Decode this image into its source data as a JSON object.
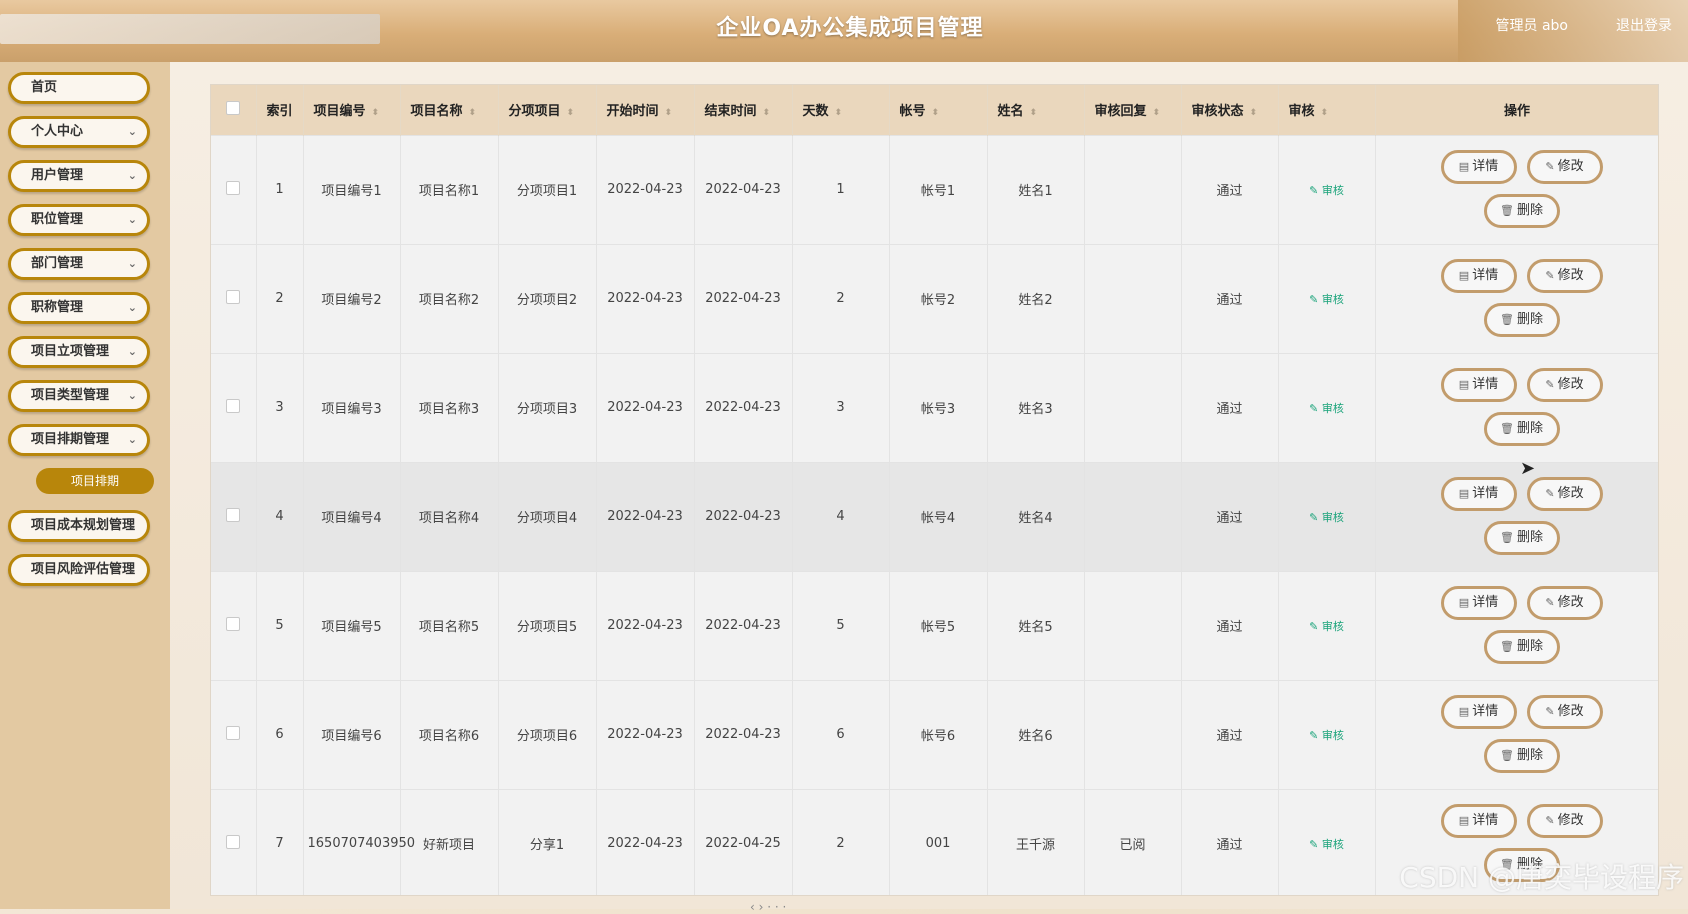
{
  "header": {
    "title": "企业OA办公集成项目管理",
    "user": "管理员 abo",
    "logout": "退出登录"
  },
  "sidebar": {
    "items": [
      {
        "label": "首页",
        "expandable": false
      },
      {
        "label": "个人中心",
        "expandable": true
      },
      {
        "label": "用户管理",
        "expandable": true
      },
      {
        "label": "职位管理",
        "expandable": true
      },
      {
        "label": "部门管理",
        "expandable": true
      },
      {
        "label": "职称管理",
        "expandable": true
      },
      {
        "label": "项目立项管理",
        "expandable": true
      },
      {
        "label": "项目类型管理",
        "expandable": true
      },
      {
        "label": "项目排期管理",
        "expandable": true
      },
      {
        "label": "项目成本规划管理",
        "expandable": true
      },
      {
        "label": "项目风险评估管理",
        "expandable": true
      }
    ],
    "active_sub": "项目排期"
  },
  "table": {
    "columns": [
      "索引",
      "项目编号",
      "项目名称",
      "分项项目",
      "开始时间",
      "结束时间",
      "天数",
      "帐号",
      "姓名",
      "审核回复",
      "审核状态",
      "审核",
      "操作"
    ],
    "rows": [
      {
        "index": "1",
        "code": "项目编号1",
        "name": "项目名称1",
        "sub": "分项项目1",
        "start": "2022-04-23",
        "end": "2022-04-23",
        "days": "1",
        "account": "帐号1",
        "person": "姓名1",
        "reply": "",
        "status": "通过"
      },
      {
        "index": "2",
        "code": "项目编号2",
        "name": "项目名称2",
        "sub": "分项项目2",
        "start": "2022-04-23",
        "end": "2022-04-23",
        "days": "2",
        "account": "帐号2",
        "person": "姓名2",
        "reply": "",
        "status": "通过"
      },
      {
        "index": "3",
        "code": "项目编号3",
        "name": "项目名称3",
        "sub": "分项项目3",
        "start": "2022-04-23",
        "end": "2022-04-23",
        "days": "3",
        "account": "帐号3",
        "person": "姓名3",
        "reply": "",
        "status": "通过"
      },
      {
        "index": "4",
        "code": "项目编号4",
        "name": "项目名称4",
        "sub": "分项项目4",
        "start": "2022-04-23",
        "end": "2022-04-23",
        "days": "4",
        "account": "帐号4",
        "person": "姓名4",
        "reply": "",
        "status": "通过"
      },
      {
        "index": "5",
        "code": "项目编号5",
        "name": "项目名称5",
        "sub": "分项项目5",
        "start": "2022-04-23",
        "end": "2022-04-23",
        "days": "5",
        "account": "帐号5",
        "person": "姓名5",
        "reply": "",
        "status": "通过"
      },
      {
        "index": "6",
        "code": "项目编号6",
        "name": "项目名称6",
        "sub": "分项项目6",
        "start": "2022-04-23",
        "end": "2022-04-23",
        "days": "6",
        "account": "帐号6",
        "person": "姓名6",
        "reply": "",
        "status": "通过"
      },
      {
        "index": "7",
        "code": "1650707403950",
        "name": "好新项目",
        "sub": "分享1",
        "start": "2022-04-23",
        "end": "2022-04-25",
        "days": "2",
        "account": "001",
        "person": "王千源",
        "reply": "已阅",
        "status": "通过"
      }
    ],
    "highlighted_row": 3,
    "audit_label": "审核",
    "buttons": {
      "detail": "详情",
      "edit": "修改",
      "delete": "删除"
    }
  },
  "watermark": "CSDN @唐奕毕设程序",
  "colors": {
    "accent": "#b8860b",
    "header_bg": "#ead7bd",
    "audit_green": "#1aa37a"
  }
}
